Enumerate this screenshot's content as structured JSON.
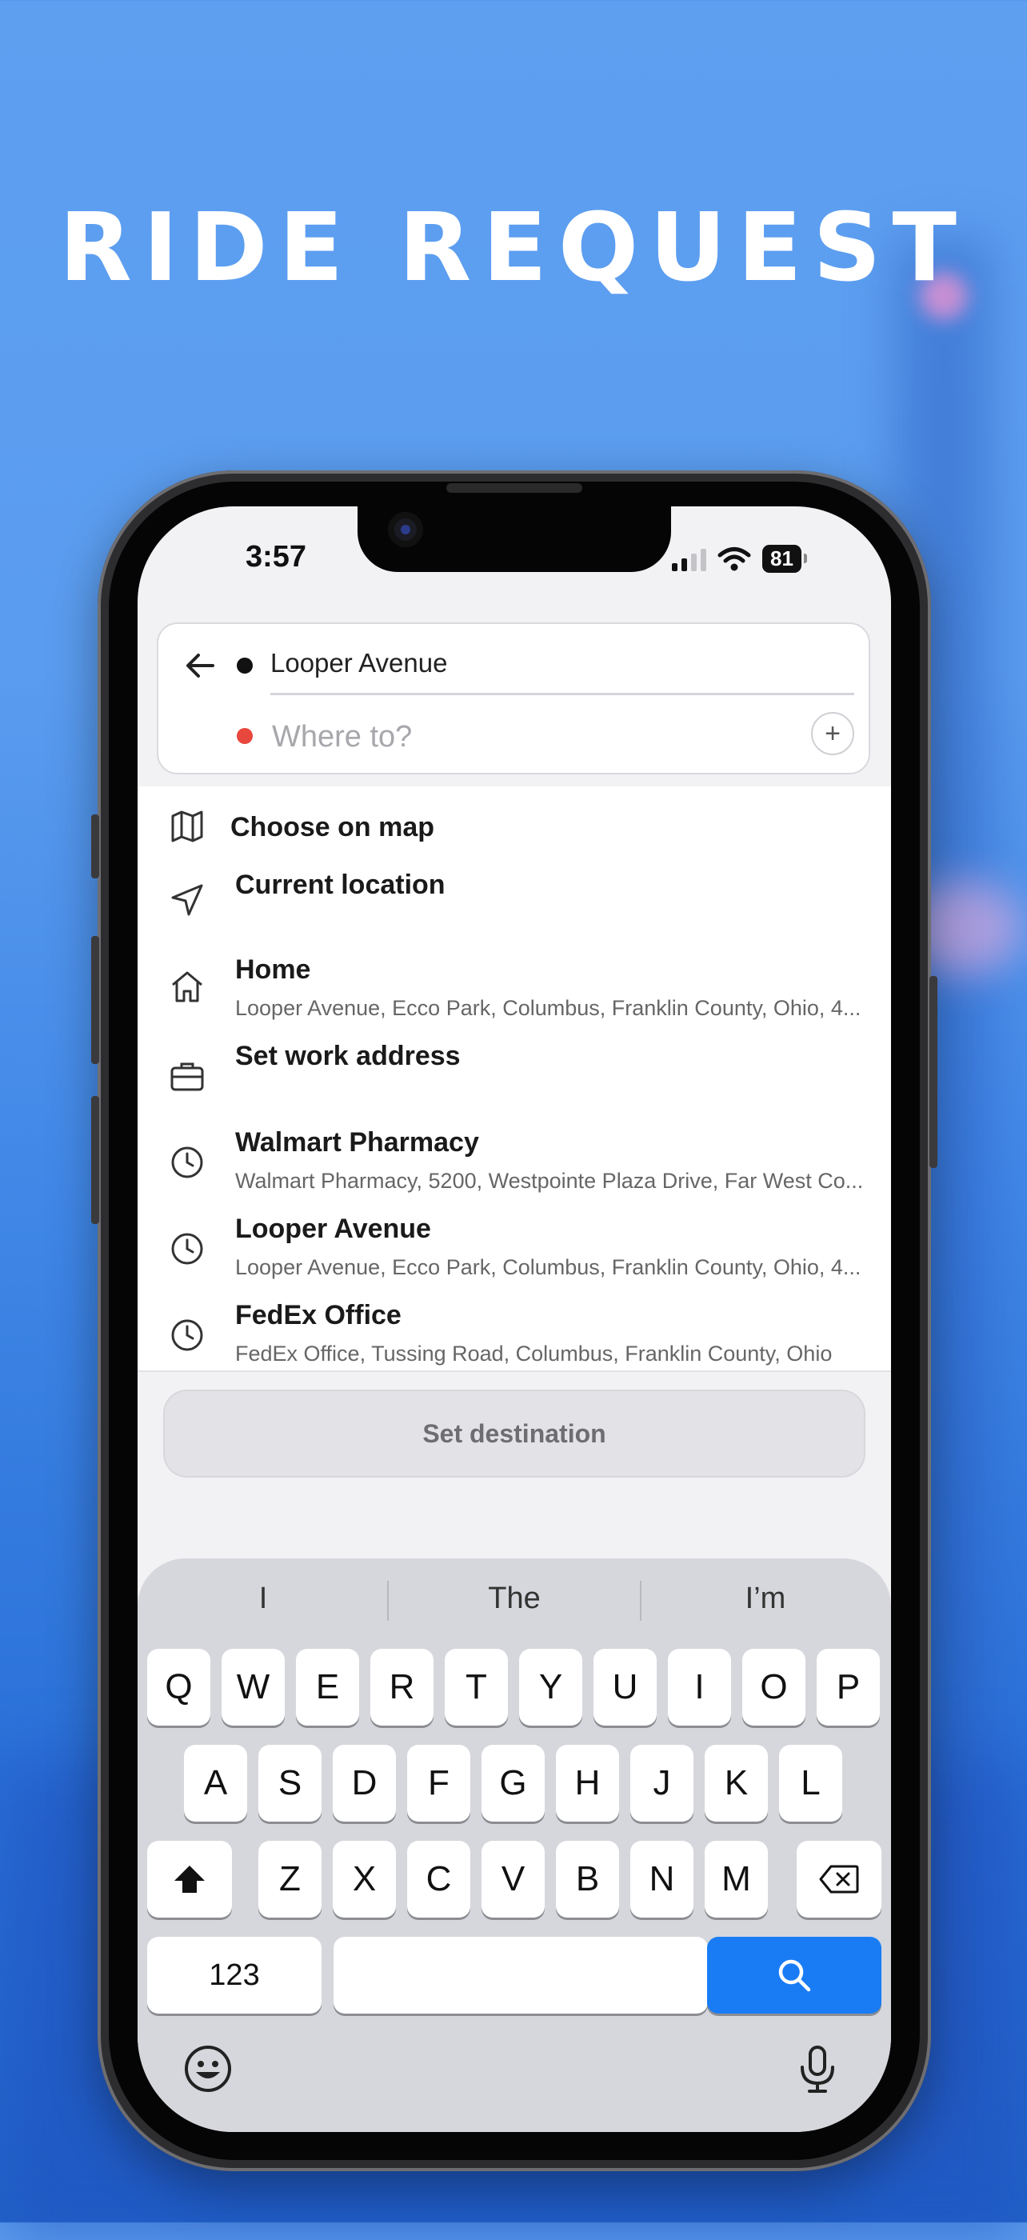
{
  "hero": {
    "title": "RIDE REQUEST"
  },
  "status_bar": {
    "time": "3:57",
    "battery": "81"
  },
  "route": {
    "origin": "Looper Avenue",
    "destination_placeholder": "Where to?",
    "destination_value": ""
  },
  "list": {
    "choose_on_map": "Choose on map",
    "current_location": "Current location",
    "home": {
      "title": "Home",
      "address": "Looper Avenue, Ecco Park, Columbus, Franklin County, Ohio, 4..."
    },
    "work": {
      "title": "Set work address"
    },
    "recents": [
      {
        "title": "Walmart Pharmacy",
        "address": "Walmart Pharmacy, 5200, Westpointe Plaza Drive, Far West Co..."
      },
      {
        "title": "Looper Avenue",
        "address": "Looper Avenue, Ecco Park, Columbus, Franklin County, Ohio, 4..."
      },
      {
        "title": "FedEx Office",
        "address": "FedEx Office, Tussing Road, Columbus, Franklin County, Ohio"
      }
    ]
  },
  "set_destination_label": "Set destination",
  "keyboard": {
    "suggestions": [
      "I",
      "The",
      "I’m"
    ],
    "row1": [
      "Q",
      "W",
      "E",
      "R",
      "T",
      "Y",
      "U",
      "I",
      "O",
      "P"
    ],
    "row2": [
      "A",
      "S",
      "D",
      "F",
      "G",
      "H",
      "J",
      "K",
      "L"
    ],
    "row3": [
      "Z",
      "X",
      "C",
      "V",
      "B",
      "N",
      "M"
    ],
    "numbers_key": "123"
  },
  "colors": {
    "accent": "#1a7cf5",
    "destination_dot": "#e8473d"
  }
}
